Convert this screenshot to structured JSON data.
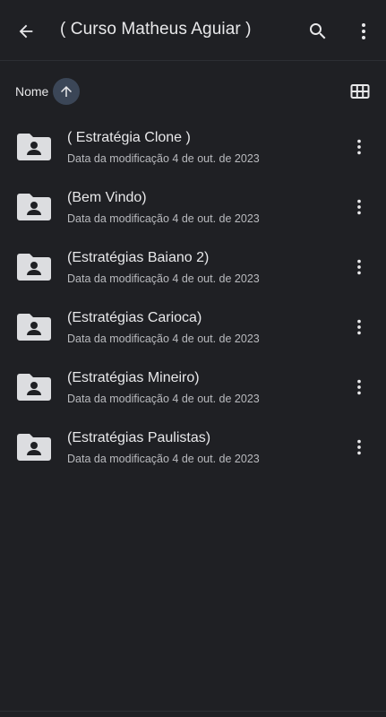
{
  "header": {
    "title": "( Curso Matheus Aguiar )",
    "back_icon": "arrow-left-icon",
    "search_icon": "search-icon",
    "more_icon": "more-vertical-icon"
  },
  "sort": {
    "label": "Nome",
    "direction_icon": "arrow-up-icon",
    "view_toggle_icon": "grid-view-icon"
  },
  "folders": [
    {
      "name": "( Estratégia Clone )",
      "meta": "Data da modificação 4 de out. de 2023"
    },
    {
      "name": "(Bem Vindo)",
      "meta": "Data da modificação 4 de out. de 2023"
    },
    {
      "name": "(Estratégias Baiano 2)",
      "meta": "Data da modificação 4 de out. de 2023"
    },
    {
      "name": "(Estratégias Carioca)",
      "meta": "Data da modificação 4 de out. de 2023"
    },
    {
      "name": "(Estratégias Mineiro)",
      "meta": "Data da modificação 4 de out. de 2023"
    },
    {
      "name": "(Estratégias Paulistas)",
      "meta": "Data da modificação 4 de out. de 2023"
    }
  ],
  "colors": {
    "background": "#1f2024",
    "sort_chip": "#3b4657",
    "text_primary": "#e8e8ea",
    "text_secondary": "#b9babe",
    "folder_icon": "#dcdde0"
  }
}
